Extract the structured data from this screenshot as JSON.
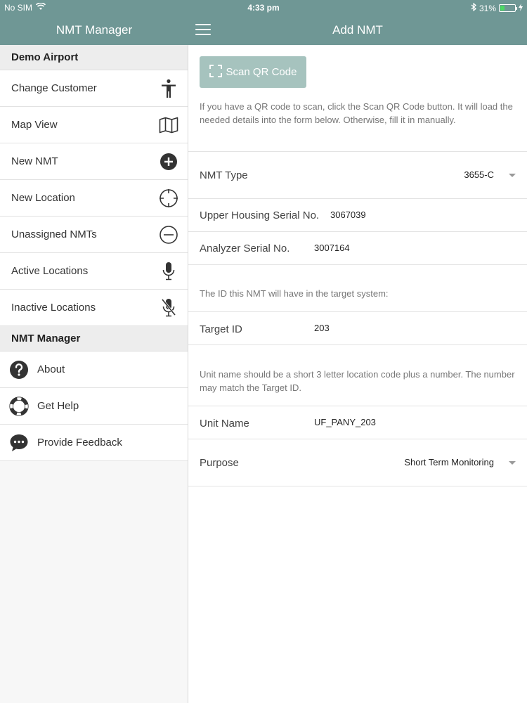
{
  "status_bar": {
    "carrier": "No SIM",
    "time": "4:33 pm",
    "battery_percent": "31%",
    "battery_level": 0.31
  },
  "sidebar": {
    "header_title": "NMT Manager",
    "section1_title": "Demo Airport",
    "section1_items": [
      {
        "label": "Change Customer",
        "icon": "person-icon"
      },
      {
        "label": "Map View",
        "icon": "map-icon"
      },
      {
        "label": "New NMT",
        "icon": "add-circle-icon"
      },
      {
        "label": "New Location",
        "icon": "crosshair-icon"
      },
      {
        "label": "Unassigned NMTs",
        "icon": "minus-circle-icon"
      },
      {
        "label": "Active Locations",
        "icon": "microphone-icon"
      },
      {
        "label": "Inactive Locations",
        "icon": "microphone-off-icon"
      }
    ],
    "section2_title": "NMT Manager",
    "section2_items": [
      {
        "label": "About",
        "icon": "question-icon"
      },
      {
        "label": "Get Help",
        "icon": "lifebuoy-icon"
      },
      {
        "label": "Provide Feedback",
        "icon": "chat-icon"
      }
    ]
  },
  "main": {
    "header_title": "Add NMT",
    "scan_button_label": "Scan QR Code",
    "scan_hint": "If you have a QR code to scan, click the Scan QR Code button. It will load the needed details into the form below. Otherwise, fill it in manually.",
    "nmt_type": {
      "label": "NMT Type",
      "value": "3655-C"
    },
    "upper_housing": {
      "label": "Upper Housing Serial No.",
      "value": "3067039"
    },
    "analyzer": {
      "label": "Analyzer Serial No.",
      "value": "3007164"
    },
    "target_hint": "The ID this NMT will have in the target system:",
    "target_id": {
      "label": "Target ID",
      "value": "203"
    },
    "unit_hint": "Unit name should be a short 3 letter location code plus a number. The number may match the Target ID.",
    "unit_name": {
      "label": "Unit Name",
      "value": "UF_PANY_203"
    },
    "purpose": {
      "label": "Purpose",
      "value": "Short Term Monitoring"
    }
  },
  "colors": {
    "header_bg": "#6f9795",
    "scan_button_bg": "#a6c3be",
    "battery_fill": "#4cd964"
  }
}
